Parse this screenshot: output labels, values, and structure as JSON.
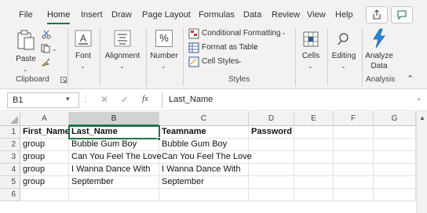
{
  "ribbon_tabs": [
    "File",
    "Home",
    "Insert",
    "Draw",
    "Page Layout",
    "Formulas",
    "Data",
    "Review",
    "View",
    "Help"
  ],
  "active_tab": "Home",
  "ribbon": {
    "clipboard": {
      "paste": "Paste",
      "group": "Clipboard"
    },
    "font": {
      "label": "Font"
    },
    "alignment": {
      "label": "Alignment"
    },
    "number": {
      "label": "Number",
      "symbol": "%"
    },
    "styles": {
      "conditional_formatting": "Conditional Formatting",
      "format_as_table": "Format as Table",
      "cell_styles": "Cell Styles",
      "group": "Styles"
    },
    "cells": {
      "label": "Cells"
    },
    "editing": {
      "label": "Editing"
    },
    "analysis": {
      "analyze_line1": "Analyze",
      "analyze_line2": "Data",
      "group": "Analysis"
    }
  },
  "formula_bar": {
    "name_box": "B1",
    "fx": "fx",
    "content": "Last_Name"
  },
  "columns": [
    "A",
    "B",
    "C",
    "D",
    "E",
    "F",
    "G"
  ],
  "selected_column": "B",
  "rows": [
    {
      "num": "1",
      "cells": [
        "First_Name",
        "Last_Name",
        "Teamname",
        "Password",
        "",
        "",
        ""
      ]
    },
    {
      "num": "2",
      "cells": [
        "group",
        "Bubble Gum Boy",
        "Bubble Gum Boy",
        "",
        "",
        "",
        ""
      ]
    },
    {
      "num": "3",
      "cells": [
        "group",
        "Can You Feel The Love",
        "Can You Feel The Love",
        "",
        "",
        "",
        ""
      ]
    },
    {
      "num": "4",
      "cells": [
        "group",
        "I Wanna Dance With",
        "I Wanna Dance With",
        "",
        "",
        "",
        ""
      ]
    },
    {
      "num": "5",
      "cells": [
        "group",
        "September",
        "September",
        "",
        "",
        "",
        ""
      ]
    },
    {
      "num": "6",
      "cells": [
        "",
        "",
        "",
        "",
        "",
        "",
        ""
      ]
    }
  ],
  "colors": {
    "accent": "#217346",
    "ribbon_bg": "#f3f2f1"
  }
}
